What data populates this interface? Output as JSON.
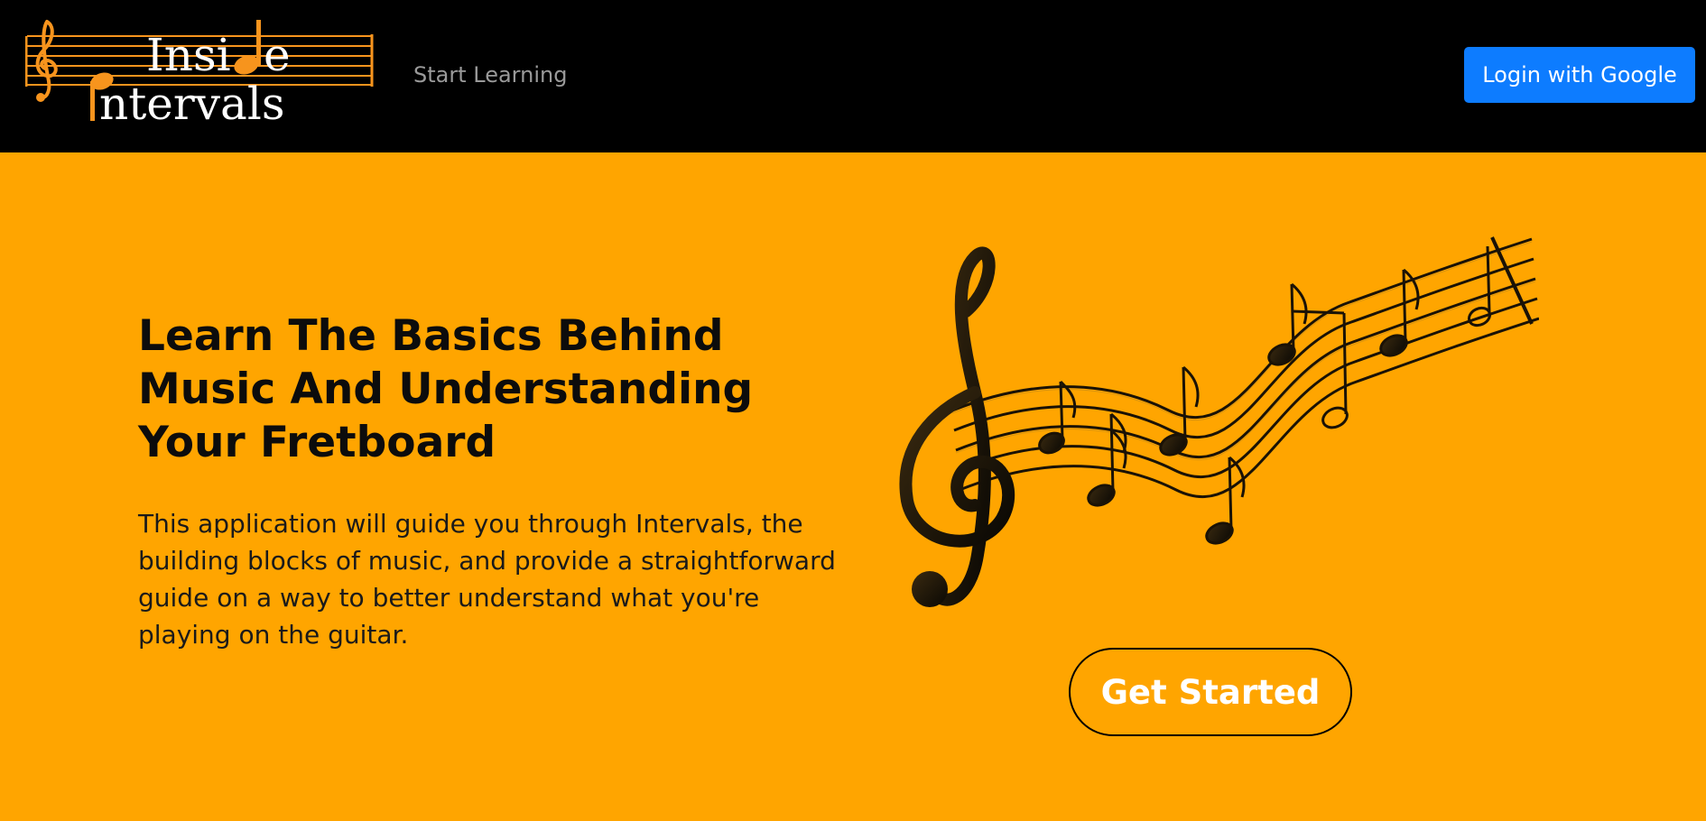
{
  "navbar": {
    "logo": {
      "line1": "Insi",
      "line1_end": "e",
      "line2": "ntervals",
      "icon": "treble-clef-staff-logo",
      "colors": {
        "staff": "#f7941d",
        "text": "#ffffff"
      }
    },
    "links": [
      {
        "label": "Start Learning"
      }
    ],
    "login_label": "Login with Google",
    "login_color": "#0d7cff"
  },
  "hero": {
    "title": "Learn The Basics Behind Music And Understanding Your Fretboard",
    "description": "This application will guide you through Intervals, the building blocks of music, and provide a straightforward guide on a way to better understand what you're playing on the guitar.",
    "illustration": "music-notes-icon",
    "cta_label": "Get Started",
    "background_color": "#ffa500"
  }
}
